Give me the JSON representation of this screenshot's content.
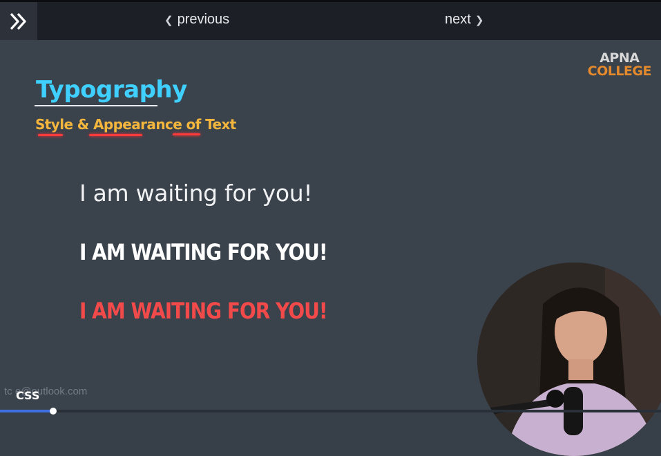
{
  "nav": {
    "previous_label": "previous",
    "next_label": "next"
  },
  "logo": {
    "line1": "APNA",
    "line2": "COLLEGE"
  },
  "slide": {
    "title": "Typography",
    "subtitle": "Style & Appearance of Text",
    "sample_normal": "I am waiting for you!",
    "sample_white": "I AM WAITING FOR YOU!",
    "sample_red": "I AM WAITING FOR YOU!",
    "watermark": "tc        e@outlook.com",
    "topic_label": "CSS"
  },
  "progress": {
    "fraction": 0.08
  },
  "colors": {
    "title": "#3fd0ff",
    "subtitle": "#f4b63d",
    "sample_red": "#f24a4a",
    "logo_orange": "#e58a2c",
    "background": "#3a424c"
  },
  "icons": {
    "expand": "double-chevron-right-icon"
  }
}
